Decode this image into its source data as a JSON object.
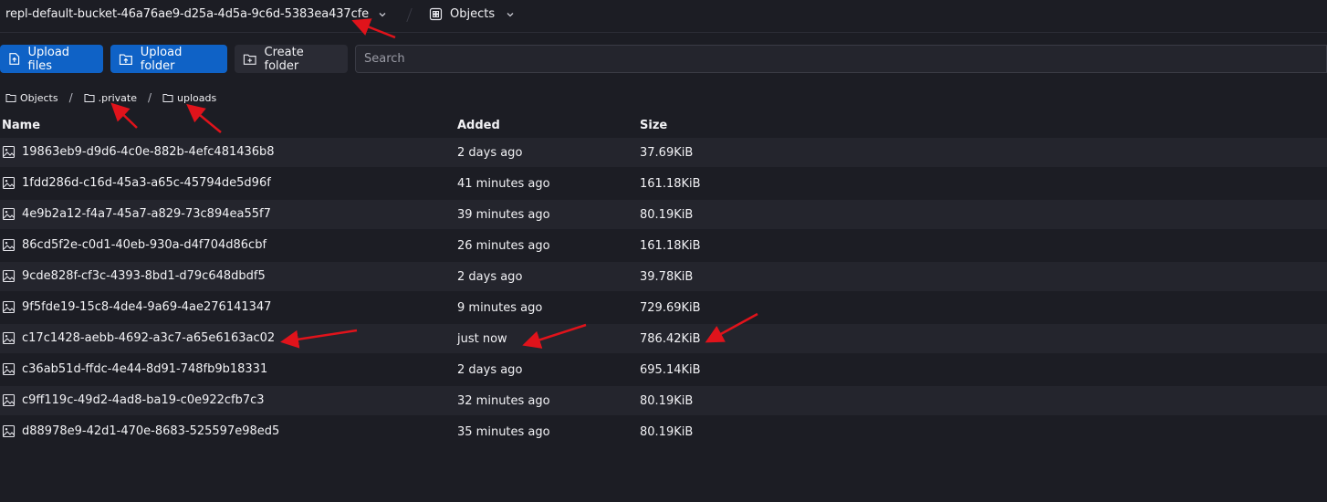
{
  "topbar": {
    "bucket_name": "repl-default-bucket-46a76ae9-d25a-4d5a-9c6d-5383ea437cfe",
    "section_label": "Objects"
  },
  "toolbar": {
    "upload_files_label": "Upload files",
    "upload_folder_label": "Upload folder",
    "create_folder_label": "Create folder",
    "search_placeholder": "Search"
  },
  "breadcrumb": [
    "Objects",
    ".private",
    "uploads"
  ],
  "table": {
    "headers": {
      "name": "Name",
      "added": "Added",
      "size": "Size"
    },
    "rows": [
      {
        "name": "19863eb9-d9d6-4c0e-882b-4efc481436b8",
        "added": "2 days ago",
        "size": "37.69KiB"
      },
      {
        "name": "1fdd286d-c16d-45a3-a65c-45794de5d96f",
        "added": "41 minutes ago",
        "size": "161.18KiB"
      },
      {
        "name": "4e9b2a12-f4a7-45a7-a829-73c894ea55f7",
        "added": "39 minutes ago",
        "size": "80.19KiB"
      },
      {
        "name": "86cd5f2e-c0d1-40eb-930a-d4f704d86cbf",
        "added": "26 minutes ago",
        "size": "161.18KiB"
      },
      {
        "name": "9cde828f-cf3c-4393-8bd1-d79c648dbdf5",
        "added": "2 days ago",
        "size": "39.78KiB"
      },
      {
        "name": "9f5fde19-15c8-4de4-9a69-4ae276141347",
        "added": "9 minutes ago",
        "size": "729.69KiB"
      },
      {
        "name": "c17c1428-aebb-4692-a3c7-a65e6163ac02",
        "added": "just now",
        "size": "786.42KiB"
      },
      {
        "name": "c36ab51d-ffdc-4e44-8d91-748fb9b18331",
        "added": "2 days ago",
        "size": "695.14KiB"
      },
      {
        "name": "c9ff119c-49d2-4ad8-ba19-c0e922cfb7c3",
        "added": "32 minutes ago",
        "size": "80.19KiB"
      },
      {
        "name": "d88978e9-42d1-470e-8683-525597e98ed5",
        "added": "35 minutes ago",
        "size": "80.19KiB"
      }
    ]
  },
  "icons": {
    "file_row": "image-file-icon",
    "folder": "folder-icon",
    "upload": "upload-icon"
  },
  "colors": {
    "background": "#1c1d24",
    "row_stripe": "#24252d",
    "primary_button": "#0f62c6",
    "annotation_arrow": "#e0131b"
  }
}
